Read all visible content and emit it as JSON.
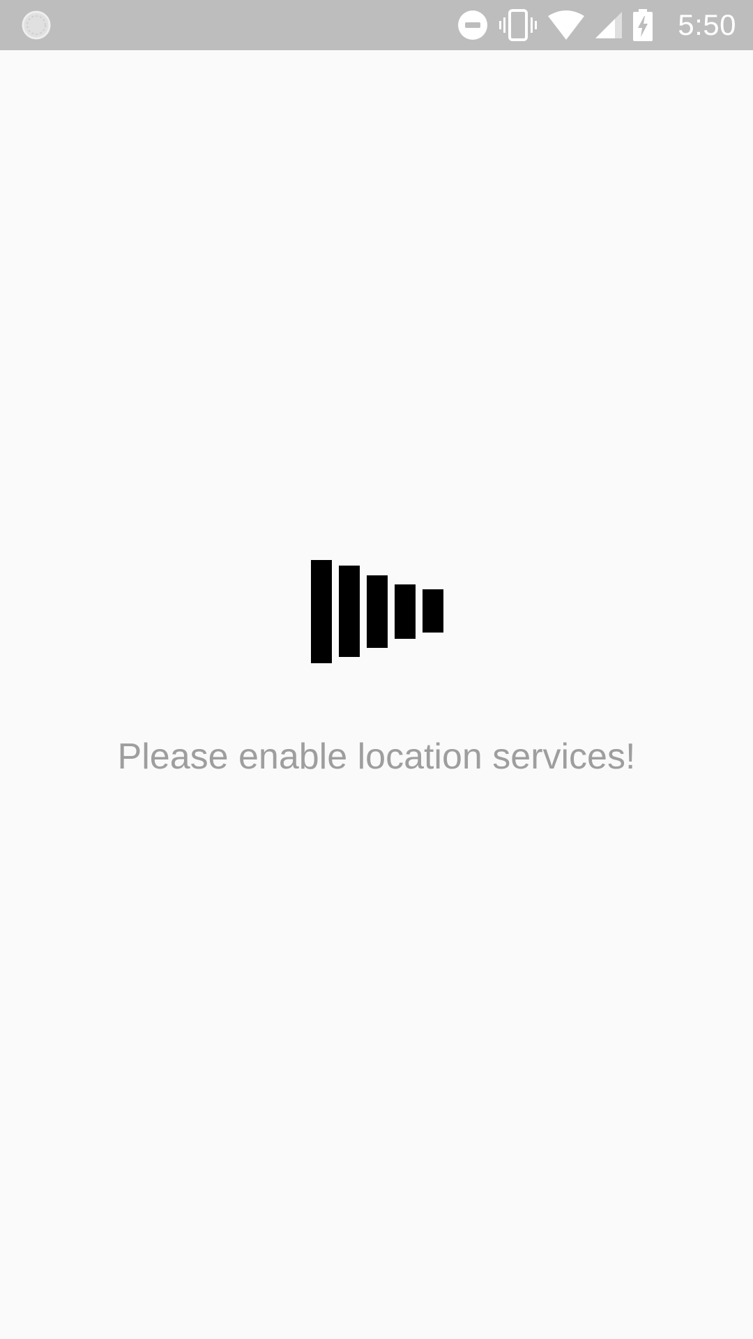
{
  "status_bar": {
    "time": "5:50",
    "icons": [
      "sync-icon",
      "do-not-disturb-icon",
      "vibrate-icon",
      "wifi-icon",
      "cell-signal-icon",
      "battery-charging-icon"
    ],
    "background_color": "#bdbdbd",
    "icon_color": "#ffffff"
  },
  "main": {
    "loader_icon": "equalizer-bars-icon",
    "message": "Please enable location services!",
    "message_color": "#9e9e9e"
  }
}
